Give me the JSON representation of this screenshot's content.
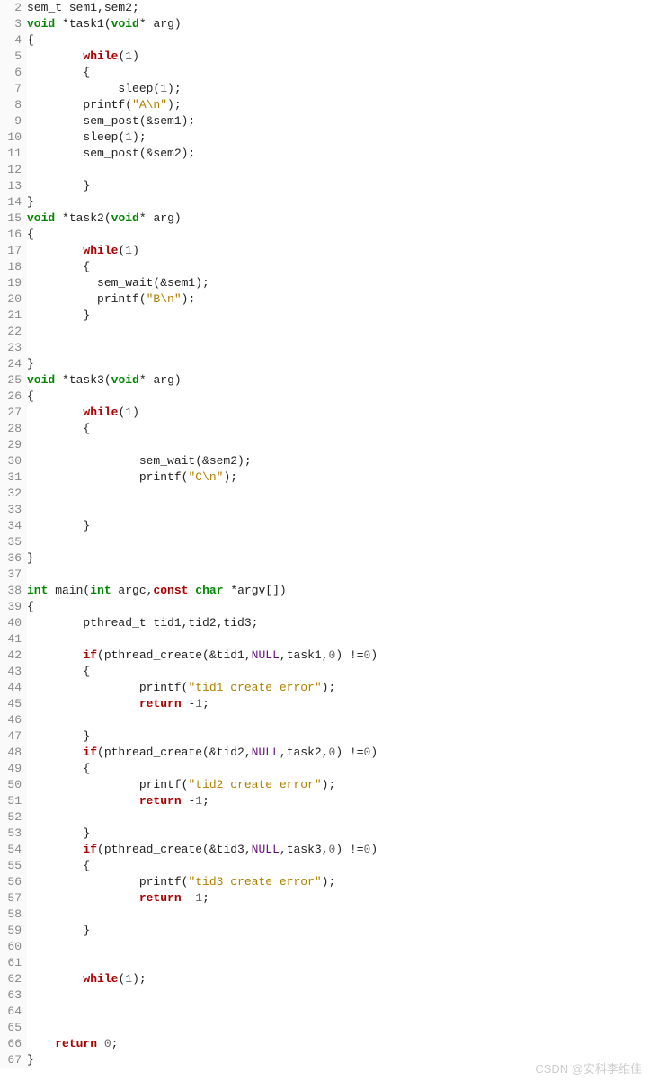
{
  "watermark": "CSDN @安科李维佳",
  "lines": [
    {
      "n": 2,
      "tokens": [
        [
          "",
          "sem_t sem1,sem2;"
        ]
      ]
    },
    {
      "n": 3,
      "tokens": [
        [
          "type",
          "void"
        ],
        [
          "",
          " *task1("
        ],
        [
          "type",
          "void"
        ],
        [
          "",
          "* arg)"
        ]
      ]
    },
    {
      "n": 4,
      "tokens": [
        [
          "",
          "{"
        ]
      ]
    },
    {
      "n": 5,
      "tokens": [
        [
          "",
          "        "
        ],
        [
          "kw",
          "while"
        ],
        [
          "",
          "("
        ],
        [
          "num",
          "1"
        ],
        [
          "",
          ")"
        ]
      ]
    },
    {
      "n": 6,
      "tokens": [
        [
          "",
          "        {"
        ]
      ]
    },
    {
      "n": 7,
      "tokens": [
        [
          "",
          "             sleep("
        ],
        [
          "num",
          "1"
        ],
        [
          "",
          ");"
        ]
      ]
    },
    {
      "n": 8,
      "tokens": [
        [
          "",
          "        printf("
        ],
        [
          "str",
          "\"A\\n\""
        ],
        [
          "",
          ");"
        ]
      ]
    },
    {
      "n": 9,
      "tokens": [
        [
          "",
          "        sem_post(&sem1);"
        ]
      ]
    },
    {
      "n": 10,
      "tokens": [
        [
          "",
          "        sleep("
        ],
        [
          "num",
          "1"
        ],
        [
          "",
          ");"
        ]
      ]
    },
    {
      "n": 11,
      "tokens": [
        [
          "",
          "        sem_post(&sem2);"
        ]
      ]
    },
    {
      "n": 12,
      "tokens": [
        [
          "",
          ""
        ]
      ]
    },
    {
      "n": 13,
      "tokens": [
        [
          "",
          "        }"
        ]
      ]
    },
    {
      "n": 14,
      "tokens": [
        [
          "",
          "}"
        ]
      ]
    },
    {
      "n": 15,
      "tokens": [
        [
          "type",
          "void"
        ],
        [
          "",
          " *task2("
        ],
        [
          "type",
          "void"
        ],
        [
          "",
          "* arg)"
        ]
      ]
    },
    {
      "n": 16,
      "tokens": [
        [
          "",
          "{"
        ]
      ]
    },
    {
      "n": 17,
      "tokens": [
        [
          "",
          "        "
        ],
        [
          "kw",
          "while"
        ],
        [
          "",
          "("
        ],
        [
          "num",
          "1"
        ],
        [
          "",
          ")"
        ]
      ]
    },
    {
      "n": 18,
      "tokens": [
        [
          "",
          "        {"
        ]
      ]
    },
    {
      "n": 19,
      "tokens": [
        [
          "",
          "          sem_wait(&sem1);"
        ]
      ]
    },
    {
      "n": 20,
      "tokens": [
        [
          "",
          "          printf("
        ],
        [
          "str",
          "\"B\\n\""
        ],
        [
          "",
          ");"
        ]
      ]
    },
    {
      "n": 21,
      "tokens": [
        [
          "",
          "        }"
        ]
      ]
    },
    {
      "n": 22,
      "tokens": [
        [
          "",
          ""
        ]
      ]
    },
    {
      "n": 23,
      "tokens": [
        [
          "",
          ""
        ]
      ]
    },
    {
      "n": 24,
      "tokens": [
        [
          "",
          "}"
        ]
      ]
    },
    {
      "n": 25,
      "tokens": [
        [
          "type",
          "void"
        ],
        [
          "",
          " *task3("
        ],
        [
          "type",
          "void"
        ],
        [
          "",
          "* arg)"
        ]
      ]
    },
    {
      "n": 26,
      "tokens": [
        [
          "",
          "{"
        ]
      ]
    },
    {
      "n": 27,
      "tokens": [
        [
          "",
          "        "
        ],
        [
          "kw",
          "while"
        ],
        [
          "",
          "("
        ],
        [
          "num",
          "1"
        ],
        [
          "",
          ")"
        ]
      ]
    },
    {
      "n": 28,
      "tokens": [
        [
          "",
          "        {"
        ]
      ]
    },
    {
      "n": 29,
      "tokens": [
        [
          "",
          ""
        ]
      ]
    },
    {
      "n": 30,
      "tokens": [
        [
          "",
          "                sem_wait(&sem2);"
        ]
      ]
    },
    {
      "n": 31,
      "tokens": [
        [
          "",
          "                printf("
        ],
        [
          "str",
          "\"C\\n\""
        ],
        [
          "",
          ");"
        ]
      ]
    },
    {
      "n": 32,
      "tokens": [
        [
          "",
          ""
        ]
      ]
    },
    {
      "n": 33,
      "tokens": [
        [
          "",
          ""
        ]
      ]
    },
    {
      "n": 34,
      "tokens": [
        [
          "",
          "        }"
        ]
      ]
    },
    {
      "n": 35,
      "tokens": [
        [
          "",
          ""
        ]
      ]
    },
    {
      "n": 36,
      "tokens": [
        [
          "",
          "}"
        ]
      ]
    },
    {
      "n": 37,
      "tokens": [
        [
          "",
          ""
        ]
      ]
    },
    {
      "n": 38,
      "tokens": [
        [
          "type",
          "int"
        ],
        [
          "",
          " main("
        ],
        [
          "type",
          "int"
        ],
        [
          "",
          " argc,"
        ],
        [
          "kw",
          "const"
        ],
        [
          "",
          " "
        ],
        [
          "type",
          "char"
        ],
        [
          "",
          " *argv[])"
        ]
      ]
    },
    {
      "n": 39,
      "tokens": [
        [
          "",
          "{"
        ]
      ]
    },
    {
      "n": 40,
      "tokens": [
        [
          "",
          "        pthread_t tid1,tid2,tid3;"
        ]
      ]
    },
    {
      "n": 41,
      "tokens": [
        [
          "",
          ""
        ]
      ]
    },
    {
      "n": 42,
      "tokens": [
        [
          "",
          "        "
        ],
        [
          "kw",
          "if"
        ],
        [
          "",
          "(pthread_create(&tid1,"
        ],
        [
          "const",
          "NULL"
        ],
        [
          "",
          ",task1,"
        ],
        [
          "num",
          "0"
        ],
        [
          "",
          ") !="
        ],
        [
          "num",
          "0"
        ],
        [
          "",
          ")"
        ]
      ]
    },
    {
      "n": 43,
      "tokens": [
        [
          "",
          "        {"
        ]
      ]
    },
    {
      "n": 44,
      "tokens": [
        [
          "",
          "                printf("
        ],
        [
          "str",
          "\"tid1 create error\""
        ],
        [
          "",
          ");"
        ]
      ]
    },
    {
      "n": 45,
      "tokens": [
        [
          "",
          "                "
        ],
        [
          "kw",
          "return"
        ],
        [
          "",
          " -"
        ],
        [
          "num",
          "1"
        ],
        [
          "",
          ";"
        ]
      ]
    },
    {
      "n": 46,
      "tokens": [
        [
          "",
          ""
        ]
      ]
    },
    {
      "n": 47,
      "tokens": [
        [
          "",
          "        }"
        ]
      ]
    },
    {
      "n": 48,
      "tokens": [
        [
          "",
          "        "
        ],
        [
          "kw",
          "if"
        ],
        [
          "",
          "(pthread_create(&tid2,"
        ],
        [
          "const",
          "NULL"
        ],
        [
          "",
          ",task2,"
        ],
        [
          "num",
          "0"
        ],
        [
          "",
          ") !="
        ],
        [
          "num",
          "0"
        ],
        [
          "",
          ")"
        ]
      ]
    },
    {
      "n": 49,
      "tokens": [
        [
          "",
          "        {"
        ]
      ]
    },
    {
      "n": 50,
      "tokens": [
        [
          "",
          "                printf("
        ],
        [
          "str",
          "\"tid2 create error\""
        ],
        [
          "",
          ");"
        ]
      ]
    },
    {
      "n": 51,
      "tokens": [
        [
          "",
          "                "
        ],
        [
          "kw",
          "return"
        ],
        [
          "",
          " -"
        ],
        [
          "num",
          "1"
        ],
        [
          "",
          ";"
        ]
      ]
    },
    {
      "n": 52,
      "tokens": [
        [
          "",
          ""
        ]
      ]
    },
    {
      "n": 53,
      "tokens": [
        [
          "",
          "        }"
        ]
      ]
    },
    {
      "n": 54,
      "tokens": [
        [
          "",
          "        "
        ],
        [
          "kw",
          "if"
        ],
        [
          "",
          "(pthread_create(&tid3,"
        ],
        [
          "const",
          "NULL"
        ],
        [
          "",
          ",task3,"
        ],
        [
          "num",
          "0"
        ],
        [
          "",
          ") !="
        ],
        [
          "num",
          "0"
        ],
        [
          "",
          ")"
        ]
      ]
    },
    {
      "n": 55,
      "tokens": [
        [
          "",
          "        {"
        ]
      ]
    },
    {
      "n": 56,
      "tokens": [
        [
          "",
          "                printf("
        ],
        [
          "str",
          "\"tid3 create error\""
        ],
        [
          "",
          ");"
        ]
      ]
    },
    {
      "n": 57,
      "tokens": [
        [
          "",
          "                "
        ],
        [
          "kw",
          "return"
        ],
        [
          "",
          " -"
        ],
        [
          "num",
          "1"
        ],
        [
          "",
          ";"
        ]
      ]
    },
    {
      "n": 58,
      "tokens": [
        [
          "",
          ""
        ]
      ]
    },
    {
      "n": 59,
      "tokens": [
        [
          "",
          "        }"
        ]
      ]
    },
    {
      "n": 60,
      "tokens": [
        [
          "",
          ""
        ]
      ]
    },
    {
      "n": 61,
      "tokens": [
        [
          "",
          ""
        ]
      ]
    },
    {
      "n": 62,
      "tokens": [
        [
          "",
          "        "
        ],
        [
          "kw",
          "while"
        ],
        [
          "",
          "("
        ],
        [
          "num",
          "1"
        ],
        [
          "",
          ");"
        ]
      ]
    },
    {
      "n": 63,
      "tokens": [
        [
          "",
          ""
        ]
      ]
    },
    {
      "n": 64,
      "tokens": [
        [
          "",
          ""
        ]
      ]
    },
    {
      "n": 65,
      "tokens": [
        [
          "",
          ""
        ]
      ]
    },
    {
      "n": 66,
      "tokens": [
        [
          "",
          "    "
        ],
        [
          "kw",
          "return"
        ],
        [
          "",
          " "
        ],
        [
          "num",
          "0"
        ],
        [
          "",
          ";"
        ]
      ]
    },
    {
      "n": 67,
      "tokens": [
        [
          "",
          "}"
        ]
      ]
    }
  ]
}
